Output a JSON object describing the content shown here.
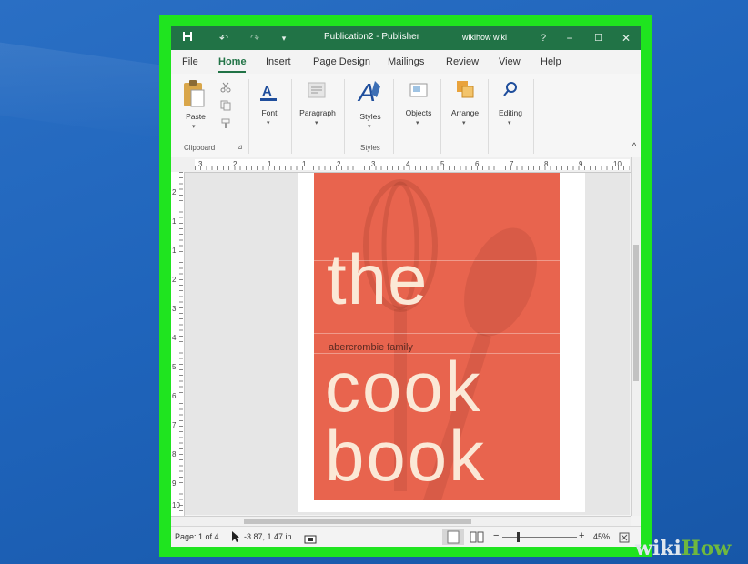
{
  "window": {
    "title": "Publication2 - Publisher",
    "user": "wikihow wiki",
    "help_glyph": "?",
    "controls": {
      "minimize": "−",
      "maximize": "☐",
      "close": "✕"
    },
    "qat": {
      "save": "save-icon",
      "undo": "↶",
      "redo": "↷",
      "customize": "▾"
    }
  },
  "menu": {
    "tabs": [
      "File",
      "Home",
      "Insert",
      "Page Design",
      "Mailings",
      "Review",
      "View",
      "Help"
    ],
    "active": "Home"
  },
  "ribbon": {
    "paste_label": "Paste",
    "clipboard_group": "Clipboard",
    "font_label": "Font",
    "paragraph_label": "Paragraph",
    "styles_label": "Styles",
    "styles_group": "Styles",
    "objects_label": "Objects",
    "arrange_label": "Arrange",
    "editing_label": "Editing",
    "caret": "▾",
    "collapse": "^",
    "launcher": "⊿"
  },
  "rulers": {
    "horizontal": [
      "3",
      "2",
      "1",
      "1",
      "2",
      "3",
      "4",
      "5",
      "6",
      "7",
      "8",
      "9",
      "10"
    ],
    "vertical": [
      "2",
      "1",
      "1",
      "2",
      "3",
      "4",
      "5",
      "6",
      "7",
      "8",
      "9",
      "10"
    ]
  },
  "cover": {
    "line1": "the",
    "family": "abercrombie family",
    "line2": "cook",
    "line3": "book",
    "background_color": "#e8644e",
    "text_color": "#fbe8d6"
  },
  "status": {
    "page": "Page: 1 of 4",
    "position": "-3.87, 1.47 in.",
    "zoom_minus": "−",
    "zoom_plus": "+",
    "zoom": "45%"
  },
  "watermark": {
    "part1": "wiki",
    "part2": "How"
  }
}
